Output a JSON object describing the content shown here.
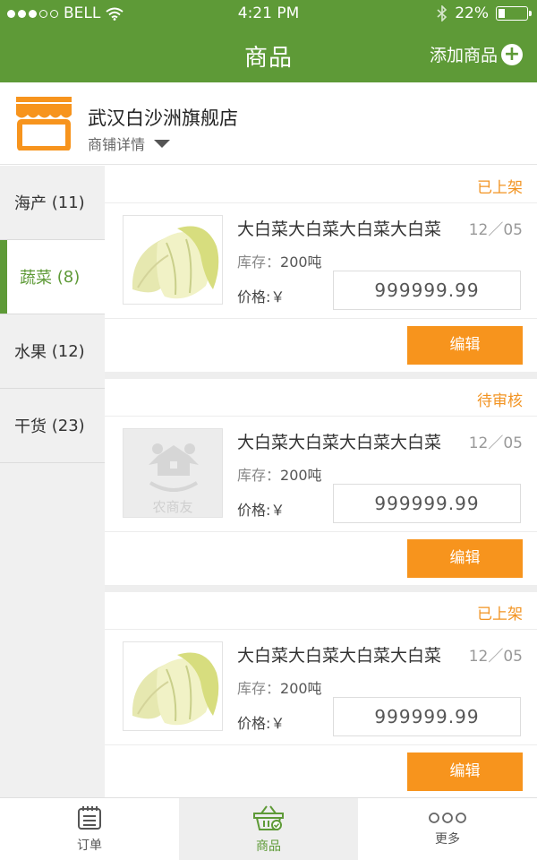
{
  "status_bar": {
    "carrier": "BELL",
    "time": "4:21 PM",
    "battery": "22%",
    "battery_level": 0.22
  },
  "nav": {
    "title": "商品",
    "add_label": "添加商品"
  },
  "shop": {
    "name": "武汉白沙洲旗舰店",
    "detail_label": "商铺详情"
  },
  "categories": [
    {
      "label": "海产",
      "count": "(11)"
    },
    {
      "label": "蔬菜",
      "count": "(8)"
    },
    {
      "label": "水果",
      "count": "(12)"
    },
    {
      "label": "干货",
      "count": "(23)"
    }
  ],
  "active_category": 1,
  "products": [
    {
      "status": "已上架",
      "name": "大白菜大白菜大白菜大白菜",
      "date": "12／05",
      "stock_label": "库存：",
      "stock": "200吨",
      "price_label": "价格:￥",
      "price": "999999.99",
      "edit": "编辑",
      "image": "cabbage"
    },
    {
      "status": "待审核",
      "name": "大白菜大白菜大白菜大白菜",
      "date": "12／05",
      "stock_label": "库存：",
      "stock": "200吨",
      "price_label": "价格:￥",
      "price": "999999.99",
      "edit": "编辑",
      "image": "placeholder",
      "placeholder_text": "农商友"
    },
    {
      "status": "已上架",
      "name": "大白菜大白菜大白菜大白菜",
      "date": "12／05",
      "stock_label": "库存：",
      "stock": "200吨",
      "price_label": "价格:￥",
      "price": "999999.99",
      "edit": "编辑",
      "image": "cabbage"
    }
  ],
  "tabs": [
    {
      "label": "订单",
      "icon": "order-icon"
    },
    {
      "label": "商品",
      "icon": "basket-icon"
    },
    {
      "label": "更多",
      "icon": "more-icon"
    }
  ],
  "colors": {
    "brand_green": "#5e9a37",
    "accent_orange": "#f7941d"
  }
}
